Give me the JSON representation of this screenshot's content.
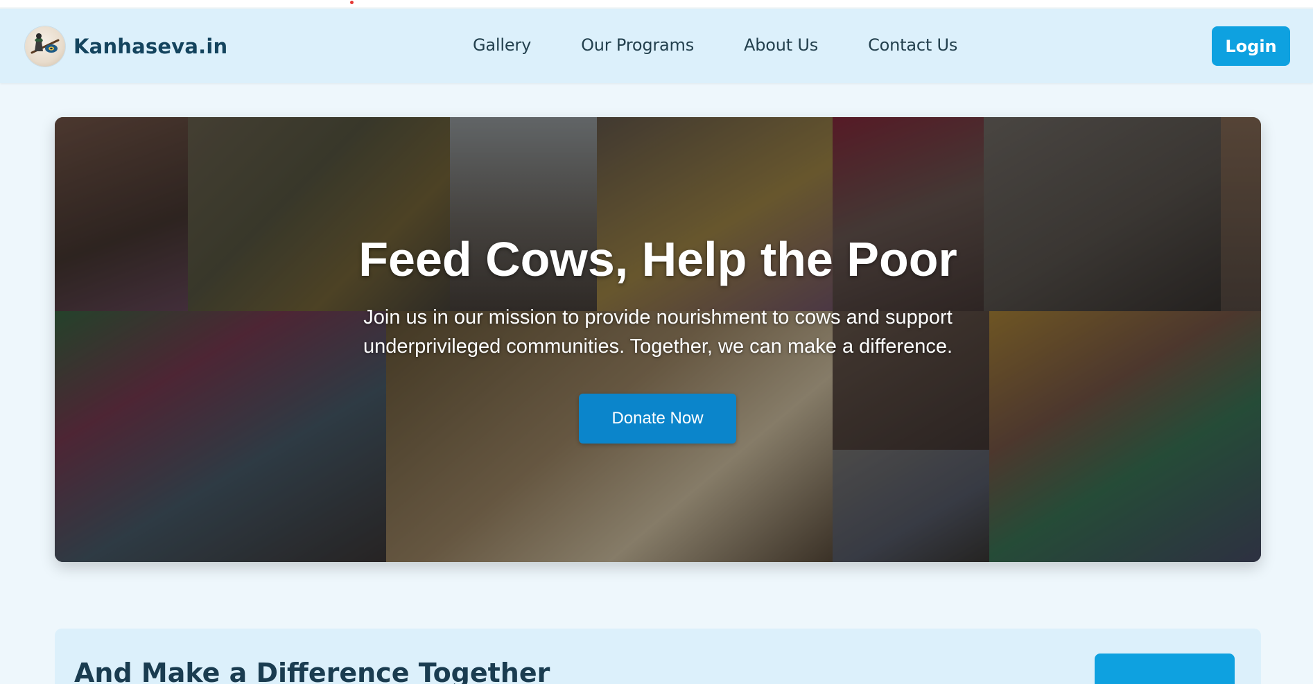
{
  "site": {
    "brand_name": "Kanhaseva.in",
    "logo_icon": "flute-peacock-feather-icon"
  },
  "nav": {
    "links": [
      "Gallery",
      "Our Programs",
      "About Us",
      "Contact Us"
    ],
    "login_label": "Login"
  },
  "hero": {
    "title": "Feed Cows, Help the Poor",
    "subtitle": "Join us in our mission to provide nourishment to cows and support underprivileged communities. Together, we can make a difference.",
    "cta_label": "Donate Now",
    "background": "photo-collage-of-children-and-people-eating-meals"
  },
  "next_section": {
    "title_partial": "And  Make a  Difference Together"
  },
  "colors": {
    "navbar_bg": "#dcf0fb",
    "page_bg": "#eef7fc",
    "brand_text": "#14445e",
    "login_bg": "#0ea1e0",
    "donate_bg": "#0b85cb"
  }
}
